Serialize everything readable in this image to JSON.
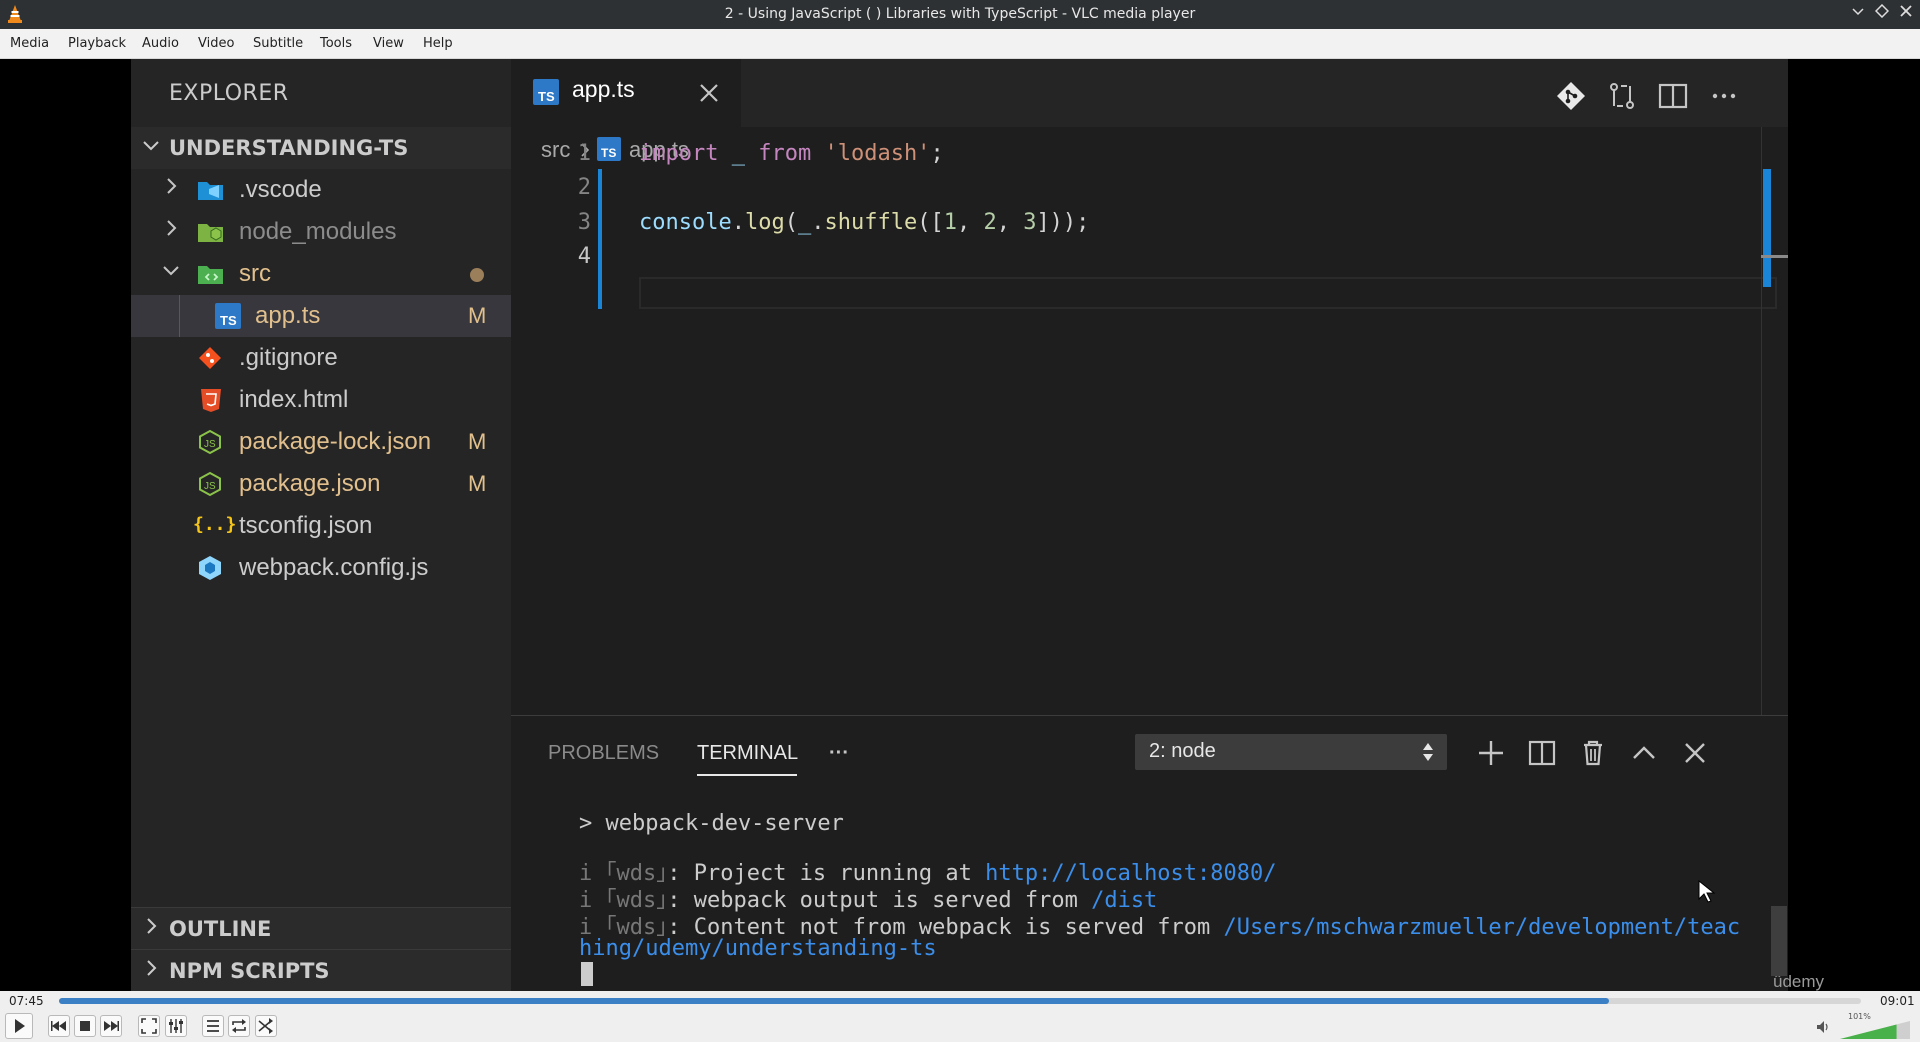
{
  "window": {
    "title": "2 - Using JavaScript ( ) Libraries with TypeScript - VLC media player"
  },
  "menubar": [
    "Media",
    "Playback",
    "Audio",
    "Video",
    "Subtitle",
    "Tools",
    "View",
    "Help"
  ],
  "vscode": {
    "sidebar": {
      "title": "EXPLORER",
      "project": "UNDERSTANDING-TS",
      "files": [
        {
          "name": ".vscode",
          "badge": ""
        },
        {
          "name": "node_modules",
          "badge": ""
        },
        {
          "name": "src",
          "badge": ""
        },
        {
          "name": "app.ts",
          "badge": "M"
        },
        {
          "name": ".gitignore",
          "badge": ""
        },
        {
          "name": "index.html",
          "badge": ""
        },
        {
          "name": "package-lock.json",
          "badge": "M"
        },
        {
          "name": "package.json",
          "badge": "M"
        },
        {
          "name": "tsconfig.json",
          "badge": ""
        },
        {
          "name": "webpack.config.js",
          "badge": ""
        }
      ],
      "outline": "OUTLINE",
      "npm_scripts": "NPM SCRIPTS"
    },
    "editor": {
      "tab": "app.ts",
      "tab_icon": "TS",
      "breadcrumb": [
        "src",
        "app.ts"
      ],
      "line_numbers": [
        "1",
        "2",
        "3",
        "4"
      ],
      "code": {
        "l1_kw": "import",
        "l1_var": "_",
        "l1_from": "from",
        "l1_str": "'lodash'",
        "l1_end": ";",
        "l3_obj": "console",
        "l3_dot": ".",
        "l3_fn": "log",
        "l3_p1": "(",
        "l3_var": "_",
        "l3_dot2": ".",
        "l3_fn2": "shuffle",
        "l3_p2": "([",
        "l3_n1": "1",
        "l3_c1": ", ",
        "l3_n2": "2",
        "l3_c2": ", ",
        "l3_n3": "3",
        "l3_end": "]));"
      }
    },
    "panel": {
      "tabs": [
        "PROBLEMS",
        "TERMINAL",
        "···"
      ],
      "terminal_select": "2: node",
      "lines": {
        "cmd": "> webpack-dev-server",
        "l1_prefix": "i ｢wds｣",
        "l1_text": ": Project is running at ",
        "l1_link": "http://localhost:8080/",
        "l2_prefix": "i ｢wds｣",
        "l2_text": ": webpack output is served from ",
        "l2_link": "/dist",
        "l3_prefix": "i ｢wds｣",
        "l3_text": ": Content not from webpack is served from ",
        "l3_link": "/Users/mschwarzmueller/development/teac",
        "l4_link": "hing/udemy/understanding-ts"
      },
      "watermark": "ûdemy"
    }
  },
  "player": {
    "elapsed": "07:45",
    "total": "09:01",
    "progress": 0.86,
    "volume_label": "101%",
    "volume": 1.01
  }
}
